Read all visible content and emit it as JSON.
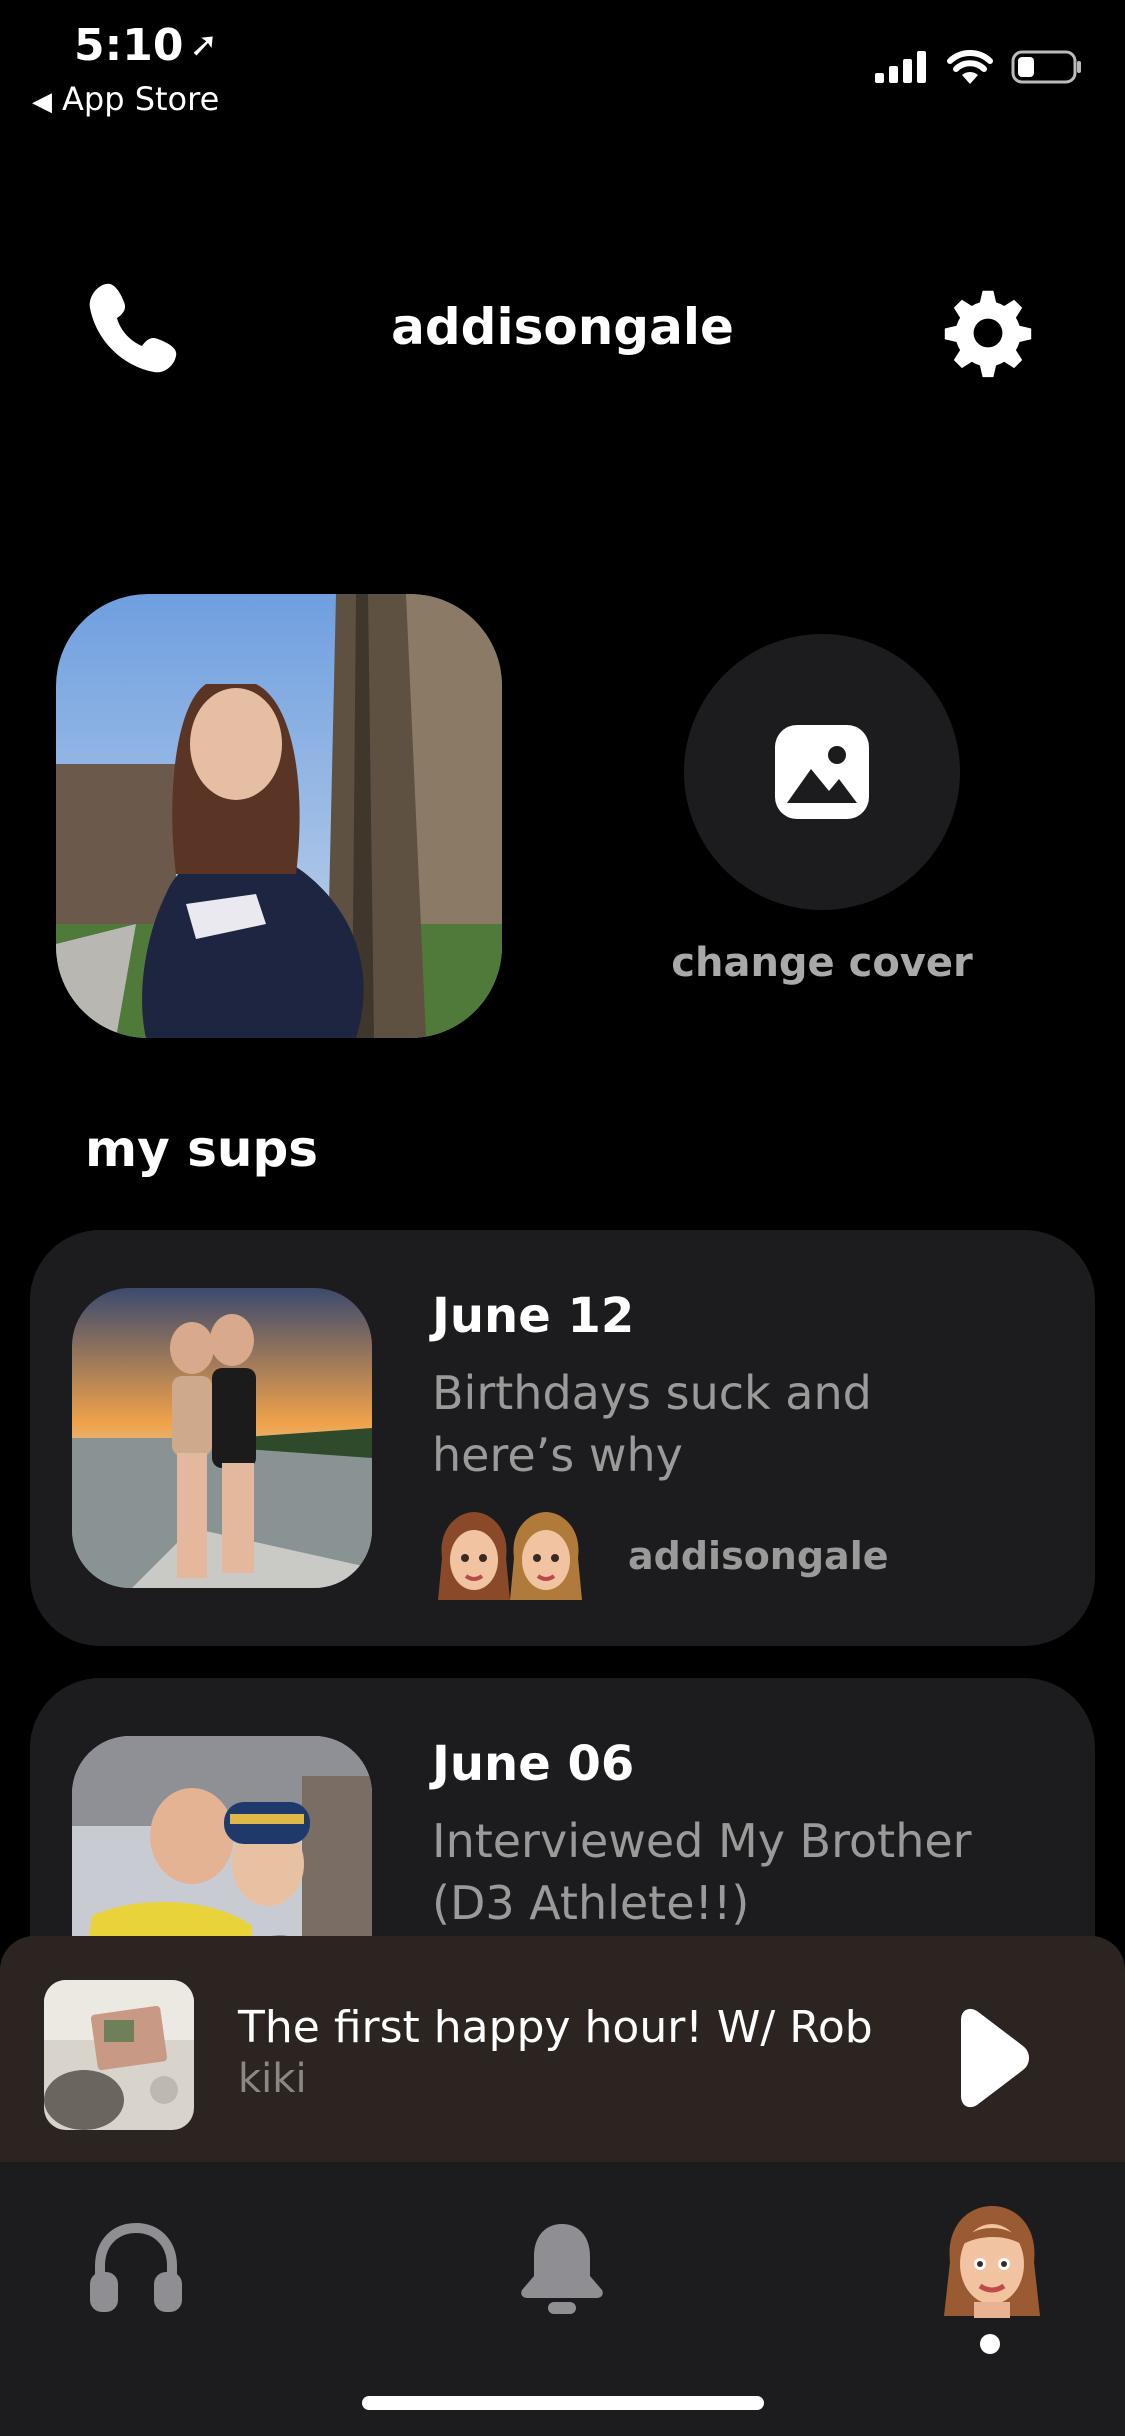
{
  "status_bar": {
    "time": "5:10",
    "back_app": "App Store"
  },
  "header": {
    "username": "addisongale",
    "left_icon": "phone-icon",
    "right_icon": "gear-icon"
  },
  "cover": {
    "change_label": "change cover",
    "icon": "image-icon"
  },
  "section": {
    "title": "my sups"
  },
  "sups": [
    {
      "date": "June 12",
      "title": "Birthdays suck and here’s why",
      "author": "addisongale"
    },
    {
      "date": "June 06",
      "title": "Interviewed My Brother (D3 Athlete!!)"
    }
  ],
  "player": {
    "title": "The first happy hour! W/ Rob",
    "artist": "kiki",
    "action_icon": "play-icon"
  },
  "tabs": [
    {
      "icon": "headphones-icon"
    },
    {
      "icon": "bell-icon"
    },
    {
      "icon": "avatar-icon",
      "active": true
    }
  ],
  "colors": {
    "background": "#000000",
    "card": "#1c1c1e",
    "muted_text": "#9a9a9a",
    "player_bg": "#2b2420"
  }
}
